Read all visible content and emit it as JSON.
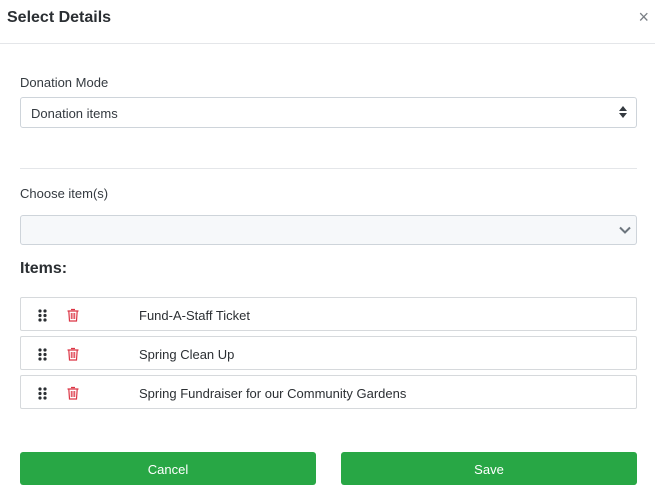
{
  "modal": {
    "title": "Select Details",
    "close_glyph": "×"
  },
  "donation_mode": {
    "label": "Donation Mode",
    "selected": "Donation items"
  },
  "choose_items": {
    "label": "Choose item(s)",
    "value": ""
  },
  "items_section": {
    "heading": "Items:",
    "items": [
      {
        "name": "Fund-A-Staff Ticket"
      },
      {
        "name": "Spring Clean Up"
      },
      {
        "name": "Spring Fundraiser for our Community Gardens"
      }
    ]
  },
  "footer": {
    "cancel_label": "Cancel",
    "save_label": "Save"
  },
  "colors": {
    "primary_green": "#28a745",
    "delete_red": "#dc3545"
  },
  "icons": {
    "close": "close-icon",
    "select_caret": "sort-caret-icon",
    "dropdown": "chevron-down-icon",
    "drag": "drag-handle-icon",
    "delete": "trash-icon"
  }
}
